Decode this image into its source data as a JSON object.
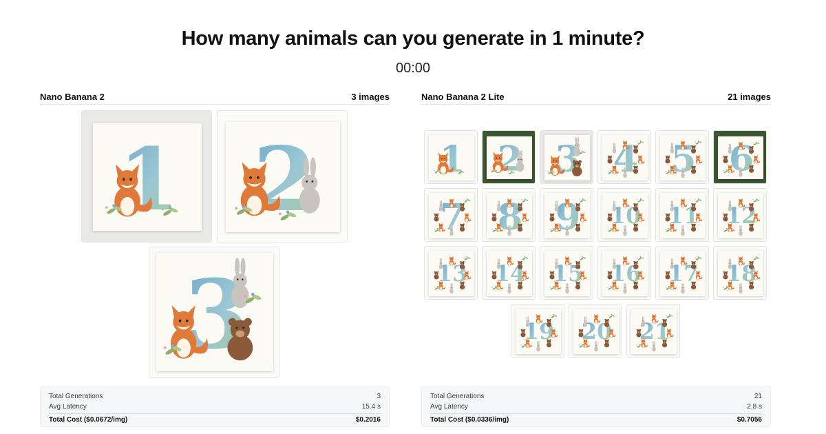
{
  "header": {
    "title": "How many animals can you generate in 1 minute?",
    "timer": "00:00"
  },
  "left": {
    "model": "Nano Banana 2",
    "count": "3 images",
    "images": [
      "1",
      "2",
      "3"
    ],
    "stats": {
      "gen_label": "Total Generations",
      "gen_value": "3",
      "lat_label": "Avg Latency",
      "lat_value": "15.4 s",
      "cost_label": "Total Cost ($0.0672/img)",
      "cost_value": "$0.2016"
    }
  },
  "right": {
    "model": "Nano Banana 2 Lite",
    "count": "21 images",
    "images": [
      "1",
      "2",
      "3",
      "4",
      "5",
      "6",
      "7",
      "8",
      "9",
      "10",
      "11",
      "12",
      "13",
      "14",
      "15",
      "16",
      "17",
      "18",
      "19",
      "20",
      "21"
    ],
    "stats": {
      "gen_label": "Total Generations",
      "gen_value": "21",
      "lat_label": "Avg Latency",
      "lat_value": "2.8 s",
      "cost_label": "Total Cost ($0.0336/img)",
      "cost_value": "$0.7056"
    }
  },
  "colors": {
    "numeral_blue": "#5b9fc4",
    "numeral_green": "#9cc27a",
    "fox": "#e07a3a",
    "bear": "#8a5a3a",
    "bunny": "#c9c4bd",
    "leaf": "#8bb06a"
  }
}
